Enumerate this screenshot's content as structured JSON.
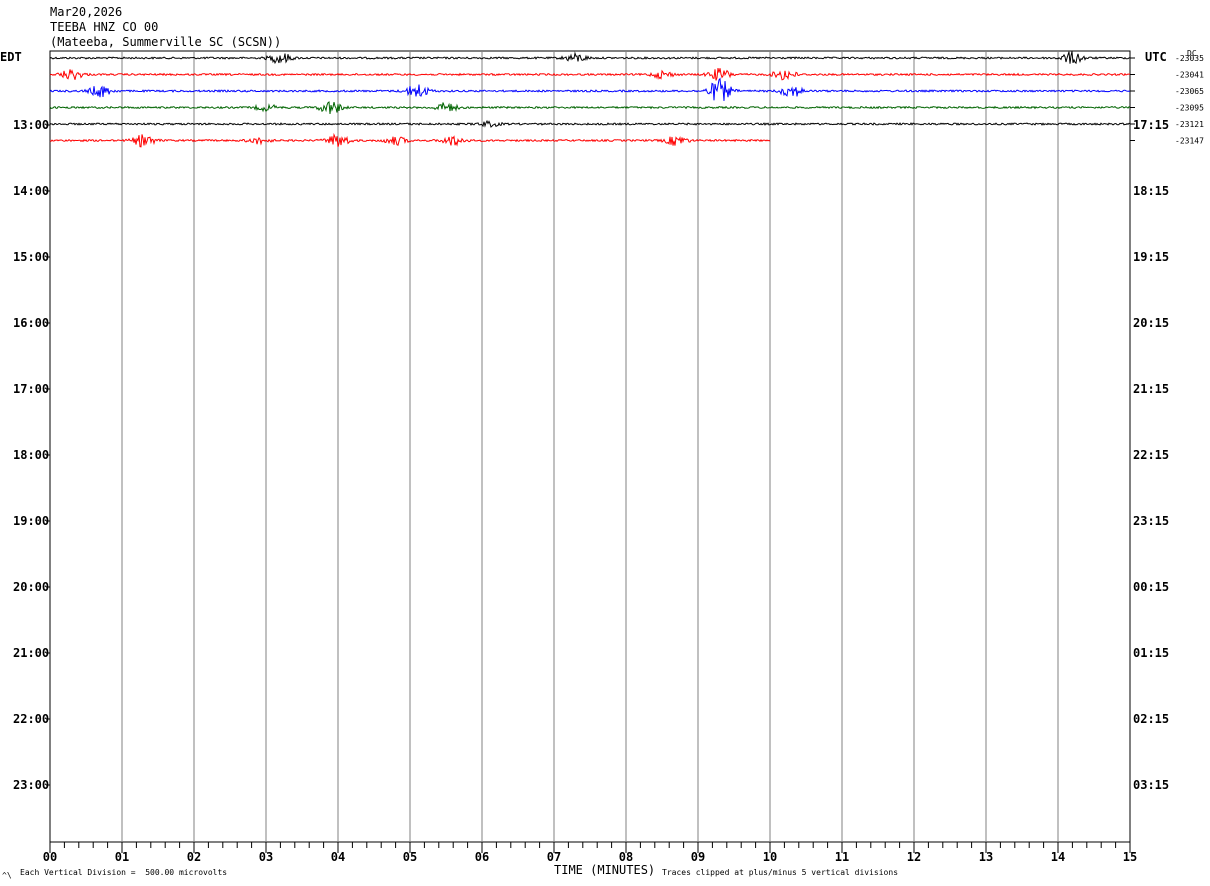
{
  "header": {
    "date": "Mar20,2026",
    "station": "TEEBA HNZ CO 00",
    "location": "(Mateeba, Summerville SC (SCSN))"
  },
  "left_zone_label": "EDT",
  "right_zone_label": "UTC",
  "dc_label": "DC",
  "footer": {
    "left_note": "Each Vertical Division =  500.00 microvolts",
    "center_label": "TIME (MINUTES)",
    "right_note": "Traces clipped at plus/minus 5 vertical divisions",
    "corner_mark": "^\\"
  },
  "colors": {
    "trace_cycle": [
      "#000000",
      "#ff0000",
      "#0000ff",
      "#006400"
    ],
    "grid": "#808080",
    "frame": "#000000"
  },
  "chart_data": {
    "type": "line",
    "title": "TEEBA HNZ CO 00",
    "xlabel": "TIME (MINUTES)",
    "x_ticks": [
      "00",
      "01",
      "02",
      "03",
      "04",
      "05",
      "06",
      "07",
      "08",
      "09",
      "10",
      "11",
      "12",
      "13",
      "14",
      "15"
    ],
    "xlim": [
      0,
      15
    ],
    "left_time_labels": [
      "13:00",
      "14:00",
      "15:00",
      "16:00",
      "17:00",
      "18:00",
      "19:00",
      "20:00",
      "21:00",
      "22:00",
      "23:00"
    ],
    "right_time_labels": [
      "17:15",
      "18:15",
      "19:15",
      "20:15",
      "21:15",
      "22:15",
      "23:15",
      "00:15",
      "01:15",
      "02:15",
      "03:15"
    ],
    "series": [
      {
        "offset": "-23035",
        "end_minute": 15,
        "bursts": [
          [
            3.2,
            0.9
          ],
          [
            7.3,
            0.7
          ],
          [
            14.2,
            1.0
          ]
        ]
      },
      {
        "offset": "-23041",
        "end_minute": 15,
        "bursts": [
          [
            0.3,
            0.9
          ],
          [
            8.5,
            0.6
          ],
          [
            9.3,
            1.0
          ],
          [
            10.2,
            0.9
          ]
        ]
      },
      {
        "offset": "-23065",
        "end_minute": 15,
        "bursts": [
          [
            0.7,
            1.0
          ],
          [
            5.1,
            1.2
          ],
          [
            9.3,
            2.0
          ],
          [
            10.3,
            1.0
          ]
        ]
      },
      {
        "offset": "-23095",
        "end_minute": 15,
        "bursts": [
          [
            3.0,
            0.5
          ],
          [
            3.9,
            1.1
          ],
          [
            5.5,
            0.8
          ]
        ]
      },
      {
        "offset": "-23121",
        "end_minute": 15,
        "bursts": [
          [
            6.1,
            0.4
          ]
        ]
      },
      {
        "offset": "-23147",
        "end_minute": 10,
        "bursts": [
          [
            1.3,
            1.0
          ],
          [
            2.9,
            0.5
          ],
          [
            4.0,
            1.1
          ],
          [
            4.8,
            0.7
          ],
          [
            5.6,
            0.8
          ],
          [
            8.7,
            0.8
          ]
        ]
      }
    ]
  }
}
